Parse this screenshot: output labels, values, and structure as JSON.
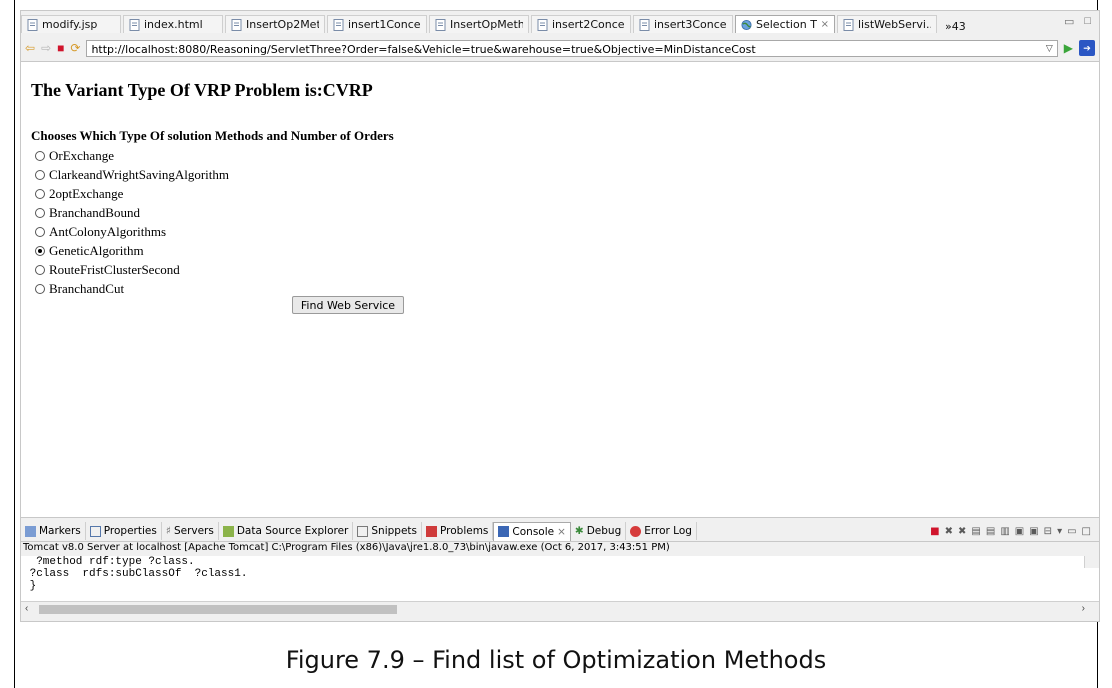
{
  "editor_tabs": [
    {
      "label": "modify.jsp"
    },
    {
      "label": "index.html"
    },
    {
      "label": "InsertOp2Met..."
    },
    {
      "label": "insert1Conce..."
    },
    {
      "label": "InsertOpMeth..."
    },
    {
      "label": "insert2Conce..."
    },
    {
      "label": "insert3Conce..."
    },
    {
      "label": "Selection Th...",
      "close": "×"
    },
    {
      "label": "listWebServi..."
    }
  ],
  "tab_overflow": "»43",
  "browser": {
    "url": "http://localhost:8080/Reasoning/ServletThree?Order=false&Vehicle=true&warehouse=true&Objective=MinDistanceCost"
  },
  "page": {
    "heading": "The Variant Type Of VRP Problem is:CVRP",
    "subheading": "Chooses Which Type Of solution Methods and Number of Orders",
    "options": [
      {
        "label": "OrExchange",
        "checked": false
      },
      {
        "label": "ClarkeandWrightSavingAlgorithm",
        "checked": false
      },
      {
        "label": "2optExchange",
        "checked": false
      },
      {
        "label": "BranchandBound",
        "checked": false
      },
      {
        "label": "AntColonyAlgorithms",
        "checked": false
      },
      {
        "label": "GeneticAlgorithm",
        "checked": true
      },
      {
        "label": "RouteFristClusterSecond",
        "checked": false
      },
      {
        "label": "BranchandCut",
        "checked": false
      }
    ],
    "button_label": "Find Web Service"
  },
  "views": {
    "tabs": [
      "Markers",
      "Properties",
      "Servers",
      "Data Source Explorer",
      "Snippets",
      "Problems",
      "Console",
      "Debug",
      "Error Log"
    ],
    "active": "Console"
  },
  "console": {
    "description": "Tomcat v8.0 Server at localhost [Apache Tomcat] C:\\Program Files (x86)\\Java\\jre1.8.0_73\\bin\\javaw.exe (Oct 6, 2017, 3:43:51 PM)",
    "lines": [
      "  ?method rdf:type ?class.",
      " ?class  rdfs:subClassOf  ?class1.",
      " }"
    ]
  },
  "caption": "Figure 7.9 – Find list of Optimization Methods",
  "colors": {
    "accent": "#2b57c4",
    "stop": "#d0142c",
    "run": "#3aa53a"
  }
}
